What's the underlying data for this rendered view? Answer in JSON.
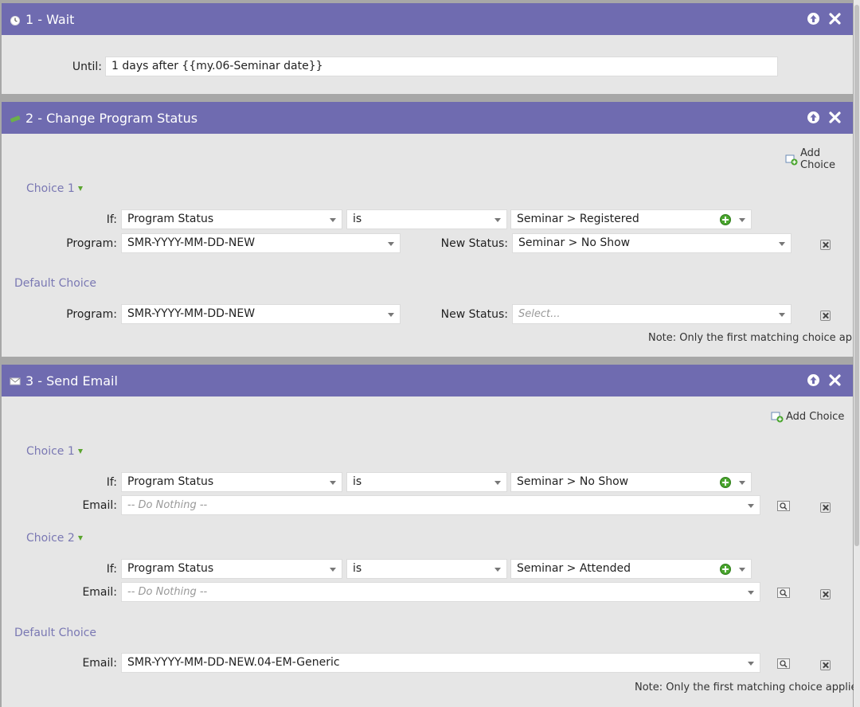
{
  "steps": [
    {
      "title": "1 - Wait",
      "icon": "clock-icon",
      "until_label": "Until:",
      "until_value": "1 days after {{my.06-Seminar date}}"
    },
    {
      "title": "2 - Change Program Status",
      "icon": "status-flag-icon",
      "add_choice": "Add Choice",
      "choice1": {
        "title": "Choice 1",
        "if_label": "If:",
        "attribute": "Program Status",
        "operator": "is",
        "value": "Seminar > Registered",
        "program_label": "Program:",
        "program": "SMR-YYYY-MM-DD-NEW",
        "new_status_label": "New Status:",
        "new_status": "Seminar > No Show"
      },
      "default": {
        "title": "Default Choice",
        "program_label": "Program:",
        "program": "SMR-YYYY-MM-DD-NEW",
        "new_status_label": "New Status:",
        "new_status_placeholder": "Select..."
      },
      "note": "Note: Only the first matching choice applies"
    },
    {
      "title": "3 - Send Email",
      "icon": "email-icon",
      "add_choice": "Add Choice",
      "choice1": {
        "title": "Choice 1",
        "if_label": "If:",
        "attribute": "Program Status",
        "operator": "is",
        "value": "Seminar > No Show",
        "email_label": "Email:",
        "email_placeholder": "-- Do Nothing --"
      },
      "choice2": {
        "title": "Choice 2",
        "if_label": "If:",
        "attribute": "Program Status",
        "operator": "is",
        "value": "Seminar > Attended",
        "email_label": "Email:",
        "email_placeholder": "-- Do Nothing --"
      },
      "default": {
        "title": "Default Choice",
        "email_label": "Email:",
        "email": "SMR-YYYY-MM-DD-NEW.04-EM-Generic"
      },
      "note": "Note: Only the first matching choice applies"
    }
  ],
  "colors": {
    "header": "#6f6bb0",
    "panel": "#e6e6e6",
    "choice_title": "#7a78b3",
    "add_green": "#4aa52e"
  }
}
